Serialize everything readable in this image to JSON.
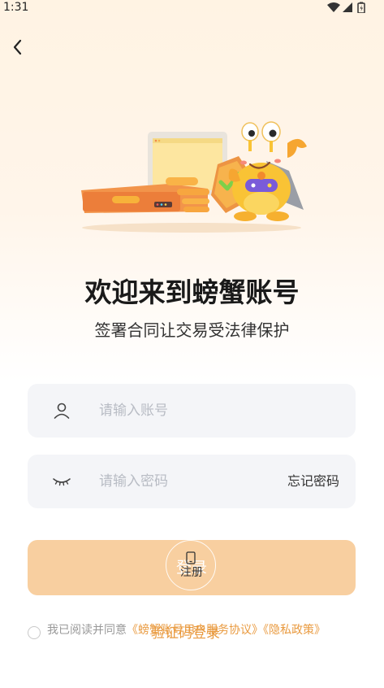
{
  "status_bar": {
    "time": "1:31",
    "icons": [
      "wifi-icon",
      "signal-icon",
      "battery-icon"
    ]
  },
  "nav": {
    "back_icon": "chevron-left-icon"
  },
  "illustration": {
    "description_icon": "crab-mascot-with-shield-icon"
  },
  "welcome": {
    "title": "欢迎来到螃蟹账号",
    "subtitle": "签署合同让交易受法律保护"
  },
  "account_field": {
    "icon": "user-icon",
    "value": "",
    "placeholder": "请输入账号"
  },
  "password_field": {
    "icon": "eye-closed-icon",
    "value": "",
    "placeholder": "请输入密码",
    "forgot_label": "忘记密码"
  },
  "login_button": {
    "label": "登录"
  },
  "register_fab": {
    "icon": "phone-icon",
    "label": "注册"
  },
  "sms_login": {
    "label": "验证码登录"
  },
  "agreement": {
    "checked": false,
    "prefix": "我已阅读并同意",
    "user_agreement": "《螃蟹账号用户服务协议》",
    "privacy_policy": "《隐私政策》"
  },
  "colors": {
    "accent": "#e99a3f",
    "button_bg": "#f8cfa0",
    "field_bg": "#f4f5f8",
    "header_gradient": "#fff3e3"
  }
}
